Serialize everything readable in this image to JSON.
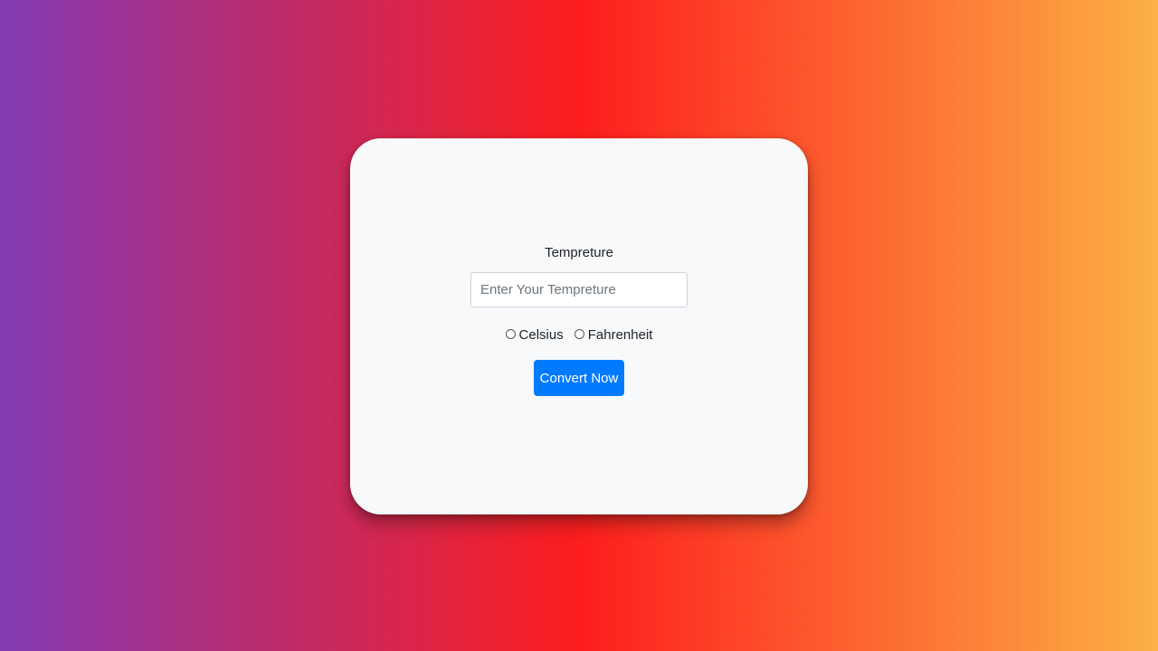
{
  "form": {
    "label": "Tempreture",
    "input": {
      "placeholder": "Enter Your Tempreture",
      "value": ""
    },
    "units": [
      {
        "label": "Celsius",
        "checked": false
      },
      {
        "label": "Fahrenheit",
        "checked": false
      }
    ],
    "submit_label": "Convert Now"
  },
  "colors": {
    "gradient_start": "#833ab4",
    "gradient_mid": "#fd1d1d",
    "gradient_end": "#fcb045",
    "card_background": "#f8f9fa",
    "button_primary": "#007bff"
  }
}
